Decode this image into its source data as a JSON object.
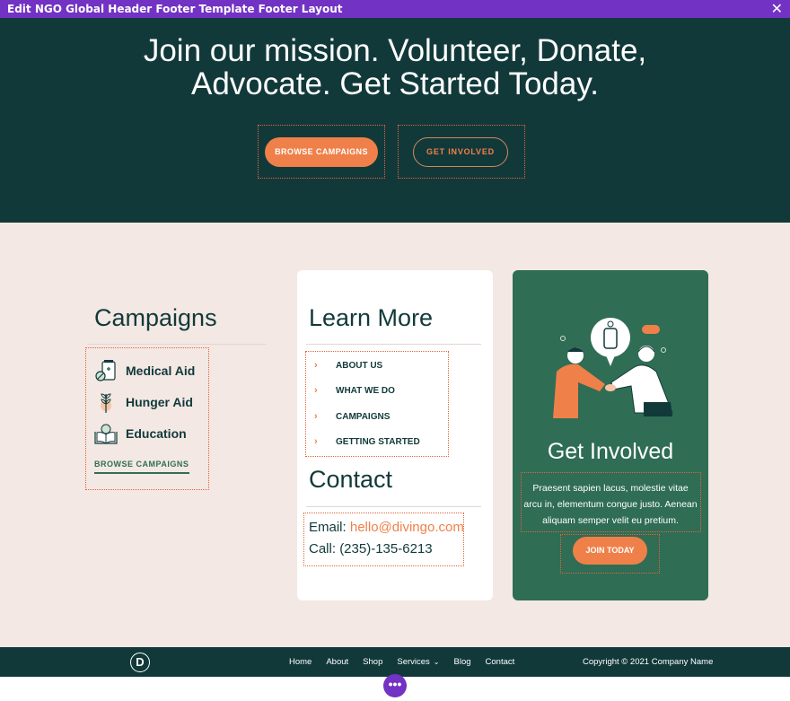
{
  "topbar": {
    "title": "Edit NGO Global Header Footer Template Footer Layout",
    "close_icon": "close-icon"
  },
  "hero": {
    "headline_line1": "Join our mission. Volunteer, Donate,",
    "headline_line2": "Advocate. Get Started Today.",
    "browse_label": "BROWSE CAMPAIGNS",
    "involved_label": "GET INVOLVED"
  },
  "campaigns": {
    "title": "Campaigns",
    "items": [
      {
        "label": "Medical Aid",
        "icon": "medical-kit-icon"
      },
      {
        "label": "Hunger Aid",
        "icon": "plant-icon"
      },
      {
        "label": "Education",
        "icon": "book-icon"
      }
    ],
    "link_label": "BROWSE CAMPAIGNS"
  },
  "learn_more": {
    "title": "Learn More",
    "items": [
      "ABOUT US",
      "WHAT WE DO",
      "CAMPAIGNS",
      "GETTING STARTED"
    ]
  },
  "contact": {
    "title": "Contact",
    "email_label": "Email:",
    "email": "hello@divingo.com",
    "call_label": "Call:",
    "phone": "(235)-135-6213"
  },
  "get_involved": {
    "title": "Get Involved",
    "text": "Praesent sapien lacus, molestie vitae arcu in, elementum congue justo. Aenean aliquam semper velit eu pretium.",
    "button_label": "JOIN TODAY"
  },
  "footer": {
    "logo_letter": "D",
    "nav": [
      "Home",
      "About",
      "Shop",
      "Services",
      "Blog",
      "Contact"
    ],
    "copyright": "Copyright © 2021 Company Name"
  },
  "fab_label": "•••",
  "colors": {
    "builder_purple": "#7232c3",
    "dark_teal": "#12393a",
    "accent_orange": "#ef8049",
    "green": "#2f6d55",
    "cream": "#f3e8e3"
  }
}
